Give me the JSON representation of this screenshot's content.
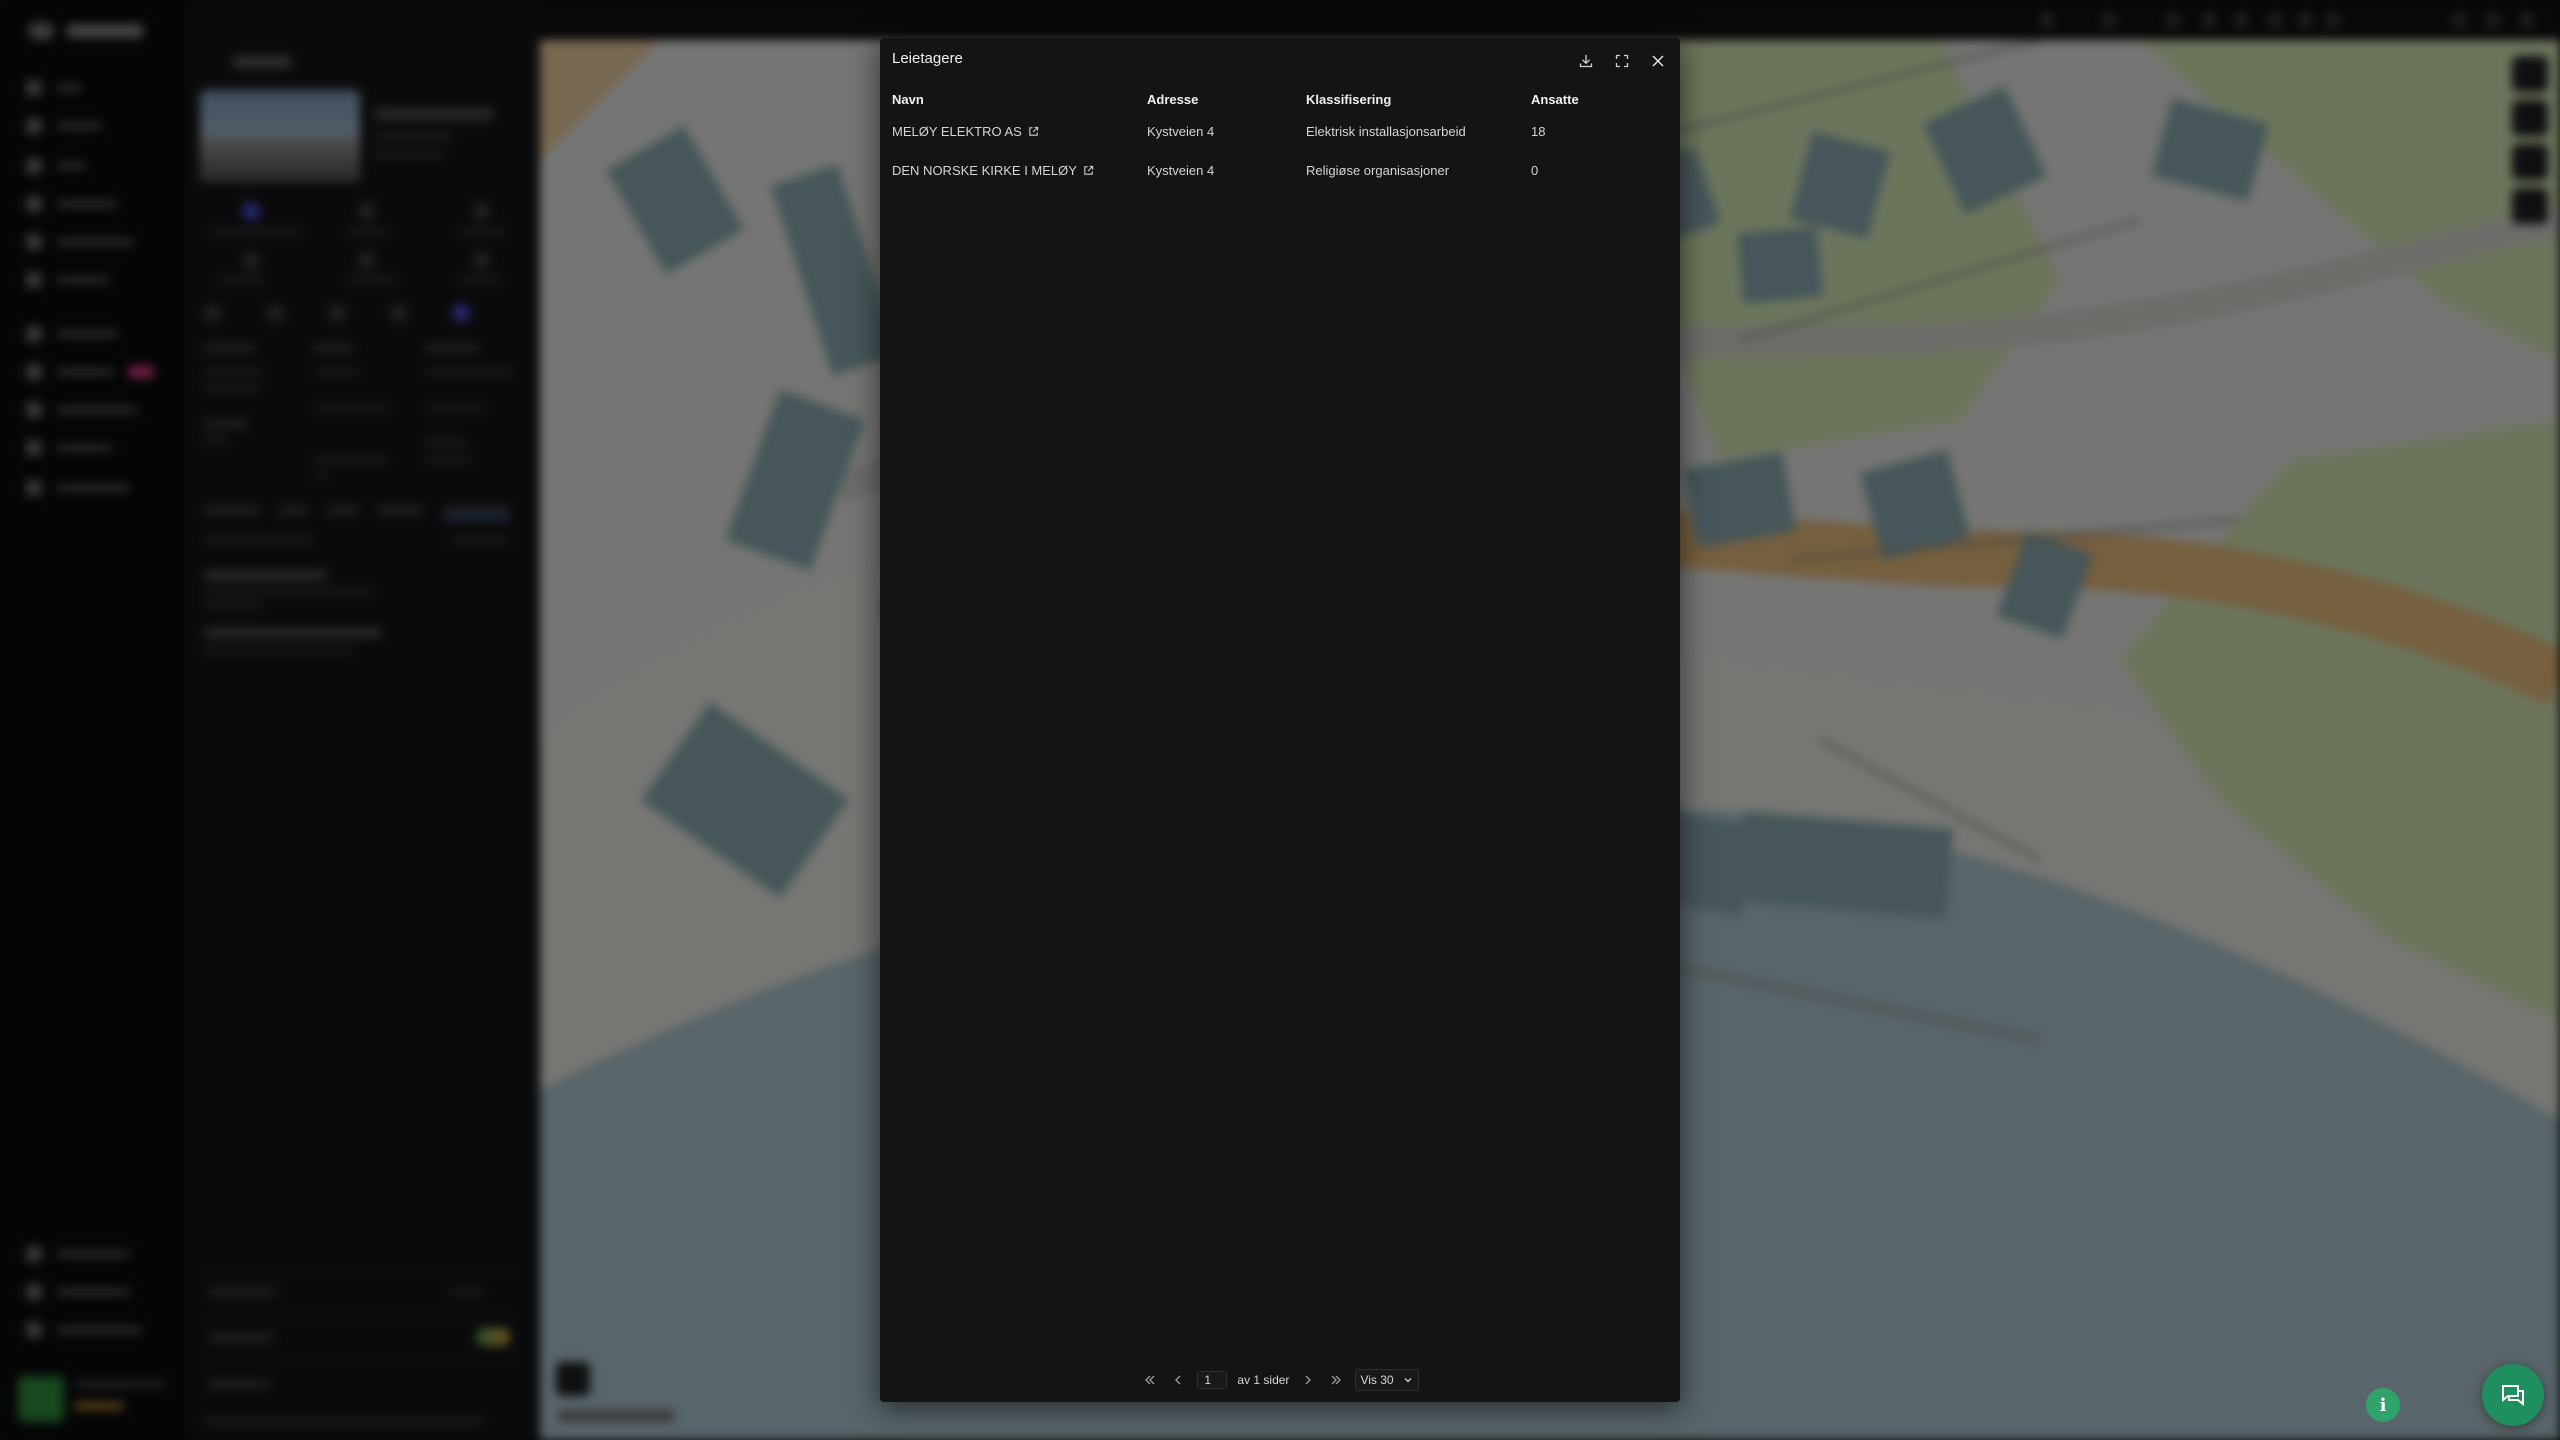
{
  "modal": {
    "title": "Leietagere",
    "actions": {
      "download_icon": "download-icon",
      "expand_icon": "expand-icon",
      "close_icon": "close-icon"
    },
    "columns": [
      "Navn",
      "Adresse",
      "Klassifisering",
      "Ansatte"
    ],
    "rows": [
      {
        "name": "MELØY ELEKTRO AS",
        "address": "Kystveien 4",
        "classification": "Elektrisk installasjonsarbeid",
        "employees": "18"
      },
      {
        "name": "DEN NORSKE KIRKE I MELØY",
        "address": "Kystveien 4",
        "classification": "Religiøse organisasjoner",
        "employees": "0"
      }
    ],
    "pagination": {
      "current_page": "1",
      "of_pages_label": "av 1 sider",
      "page_size_label": "Vis 30"
    }
  },
  "colors": {
    "modal_background": "#121416",
    "chat_button": "#1f8f5f",
    "info_button": "#2fa36b"
  }
}
